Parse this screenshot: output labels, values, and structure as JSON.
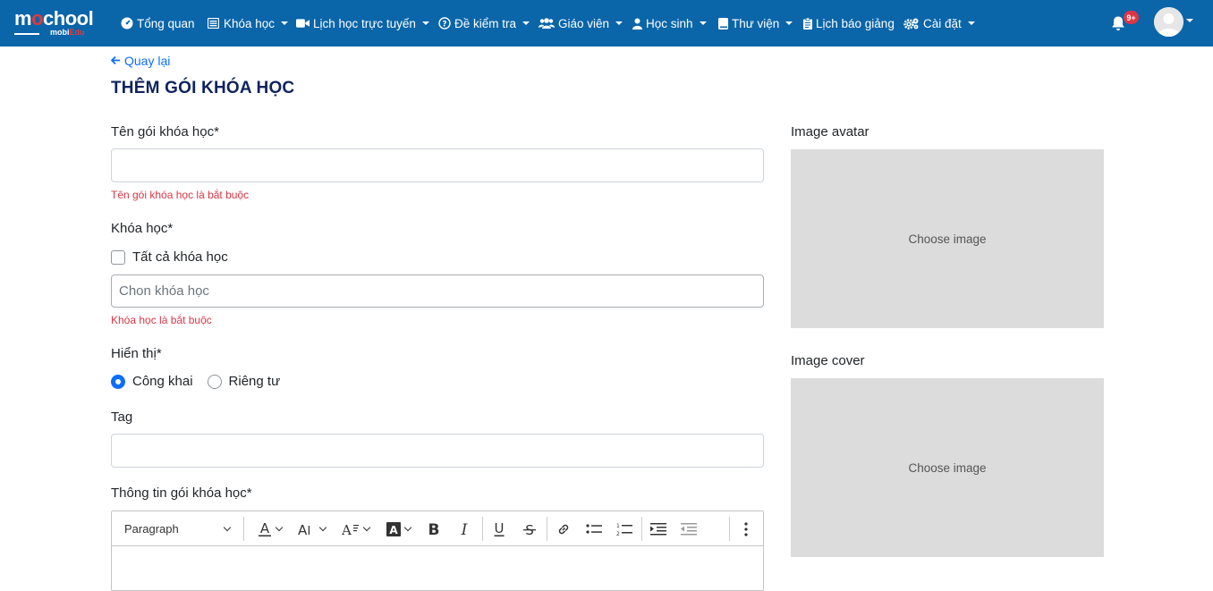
{
  "nav": {
    "logo": {
      "text_m": "m",
      "text_o": "o",
      "text_rest": "chool",
      "sub": "mobi",
      "sub_red": "Edu"
    },
    "items": [
      {
        "label": "Tổng quan",
        "icon": "dashboard-icon",
        "dropdown": false
      },
      {
        "label": "Khóa học",
        "icon": "list-icon",
        "dropdown": true
      },
      {
        "label": "Lịch học trực tuyến",
        "icon": "video-icon",
        "dropdown": true
      },
      {
        "label": "Đề kiểm tra",
        "icon": "question-icon",
        "dropdown": true
      },
      {
        "label": "Giáo viên",
        "icon": "users-icon",
        "dropdown": true
      },
      {
        "label": "Học sinh",
        "icon": "user-icon",
        "dropdown": true
      },
      {
        "label": "Thư viện",
        "icon": "book-icon",
        "dropdown": true
      },
      {
        "label": "Lịch báo giảng",
        "icon": "clipboard-icon",
        "dropdown": false
      },
      {
        "label": "Cài đặt",
        "icon": "gears-icon",
        "dropdown": true
      }
    ],
    "notifications": {
      "count": "9+"
    },
    "colors": {
      "navbar": "#0a65a9",
      "badge": "#dc3545"
    }
  },
  "page": {
    "back_label": "Quay lại",
    "title": "THÊM GÓI KHÓA HỌC"
  },
  "form": {
    "name": {
      "label": "Tên gói khóa học*",
      "value": "",
      "error": "Tên gói khóa học là bắt buộc"
    },
    "course": {
      "label": "Khóa học*",
      "all_label": "Tất cả khóa học",
      "all_checked": false,
      "placeholder": "Chon khóa học",
      "error": "Khóa học là bắt buộc"
    },
    "visibility": {
      "label": "Hiển thị*",
      "options": [
        "Công khai",
        "Riêng tư"
      ],
      "selected": "Công khai"
    },
    "tag": {
      "label": "Tag",
      "value": ""
    },
    "info": {
      "label": "Thông tin gói khóa học*",
      "toolbar": {
        "heading": "Paragraph",
        "tools": [
          "font-color-icon",
          "font-size-icon",
          "font-family-icon",
          "highlight-icon",
          "bold-icon",
          "italic-icon",
          "underline-icon",
          "strikethrough-icon",
          "link-icon",
          "bulleted-list-icon",
          "numbered-list-icon",
          "indent-icon",
          "outdent-icon",
          "more-icon"
        ]
      }
    }
  },
  "images": {
    "avatar": {
      "label": "Image avatar",
      "button": "Choose image"
    },
    "cover": {
      "label": "Image cover",
      "button": "Choose image"
    }
  }
}
